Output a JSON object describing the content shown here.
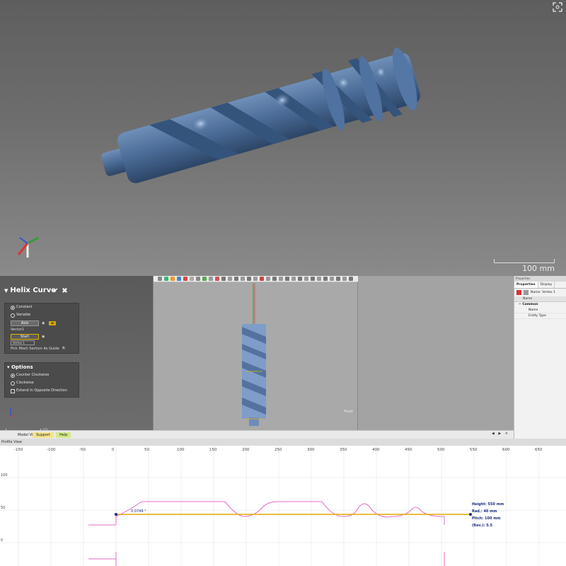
{
  "viewport": {
    "scale_label": "100 mm",
    "colors": {
      "part": "#4a6b96",
      "background_top": "#5e5e5e",
      "background_bottom": "#8a8a8a"
    }
  },
  "helix_panel": {
    "title": "Helix Curve",
    "method_options": [
      "Constant",
      "Variable"
    ],
    "method_selected": "Constant",
    "axis_label": "Axis",
    "axis_sub": "Vector1",
    "start_label": "Start",
    "start_value": "Vertex 1",
    "guide_label": "Pick Mesh Section As Guide",
    "options_title": "Options",
    "direction_options": [
      "Counter Clockwise",
      "Clockwise"
    ],
    "direction_selected": "Counter Clockwise",
    "extend_label": "Extend In Opposite Direction",
    "scale_label": "250 mm"
  },
  "center_view": {
    "label": "Front"
  },
  "properties": {
    "header": "Properties",
    "tabs": [
      "Properties",
      "Display"
    ],
    "name_value": "Name: Vertex 1",
    "column": "Name",
    "category": "Common",
    "rows": [
      "Name",
      "Entity Type"
    ]
  },
  "ribbon": {
    "tabs": [
      "Model View",
      "Support",
      "Help"
    ],
    "arrows": "◀ ▶ ×"
  },
  "profile_view": {
    "title": "Profile View",
    "x_ticks": [
      "-150",
      "-100",
      "-50",
      "0",
      "50",
      "100",
      "150",
      "200",
      "250",
      "300",
      "350",
      "400",
      "450",
      "500",
      "550",
      "600",
      "650"
    ],
    "y_ticks": [
      "100",
      "50",
      "0",
      "-50"
    ],
    "angle_label": "0.0749 °",
    "info": [
      "Height: 550 mm",
      "Rad.: 40 mm",
      "Pitch: 100 mm",
      "(Rev.): 5.5"
    ]
  }
}
